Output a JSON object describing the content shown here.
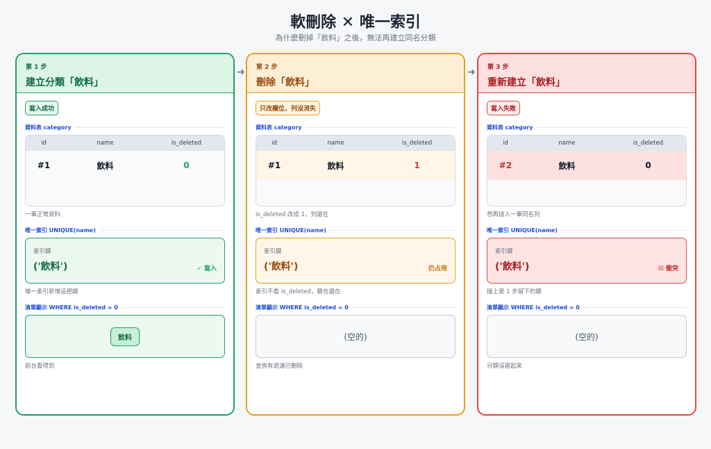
{
  "header": {
    "title": "軟刪除 ✕ 唯一索引",
    "subtitle": "為什麼刪掉「飲料」之後，無法再建立同名分類"
  },
  "arrow_glyph": "➜",
  "table": {
    "section_label": "資料表 category",
    "columns": [
      "id",
      "name",
      "is_deleted"
    ]
  },
  "index": {
    "section_label": "唯一索引  UNIQUE(name)",
    "key_label": "索引鍵"
  },
  "list": {
    "section_label": "清單顯示  WHERE is_deleted = 0"
  },
  "steps": [
    {
      "step_label": "第 1 步",
      "title": "建立分類「飲料」",
      "badge": "寫入成功",
      "row": {
        "id": "#1",
        "name": "飲料",
        "is_deleted": "0"
      },
      "table_note": "一筆正常資料",
      "index_key": "('飲料')",
      "index_status": "✓ 寫入",
      "index_note": "唯一索引新增這把鍵",
      "list_item": "飲料",
      "list_note": "前台看得到"
    },
    {
      "step_label": "第 2 步",
      "title": "刪除「飲料」",
      "badge": "只改欄位，列沒消失",
      "row": {
        "id": "#1",
        "name": "飲料",
        "is_deleted": "1"
      },
      "table_note": "is_deleted 改成 1，列還在",
      "index_key": "('飲料')",
      "index_status": "仍占用",
      "index_note": "索引不看 is_deleted，鍵也還在",
      "list_item": "(空的)",
      "list_note": "查詢有過濾已刪除"
    },
    {
      "step_label": "第 3 步",
      "title": "重新建立「飲料」",
      "badge": "寫入失敗",
      "row": {
        "id": "#2",
        "name": "飲料",
        "is_deleted": "0"
      },
      "table_note": "想再插入一筆同名列",
      "index_key": "('飲料')",
      "index_status": "☒ 衝突",
      "index_note": "撞上第 1 步留下的鍵",
      "list_item": "(空的)",
      "list_note": "分類沒建起來"
    }
  ],
  "colors": {
    "success": "#1f9e67",
    "warning": "#e79f1b",
    "danger": "#e04848"
  }
}
